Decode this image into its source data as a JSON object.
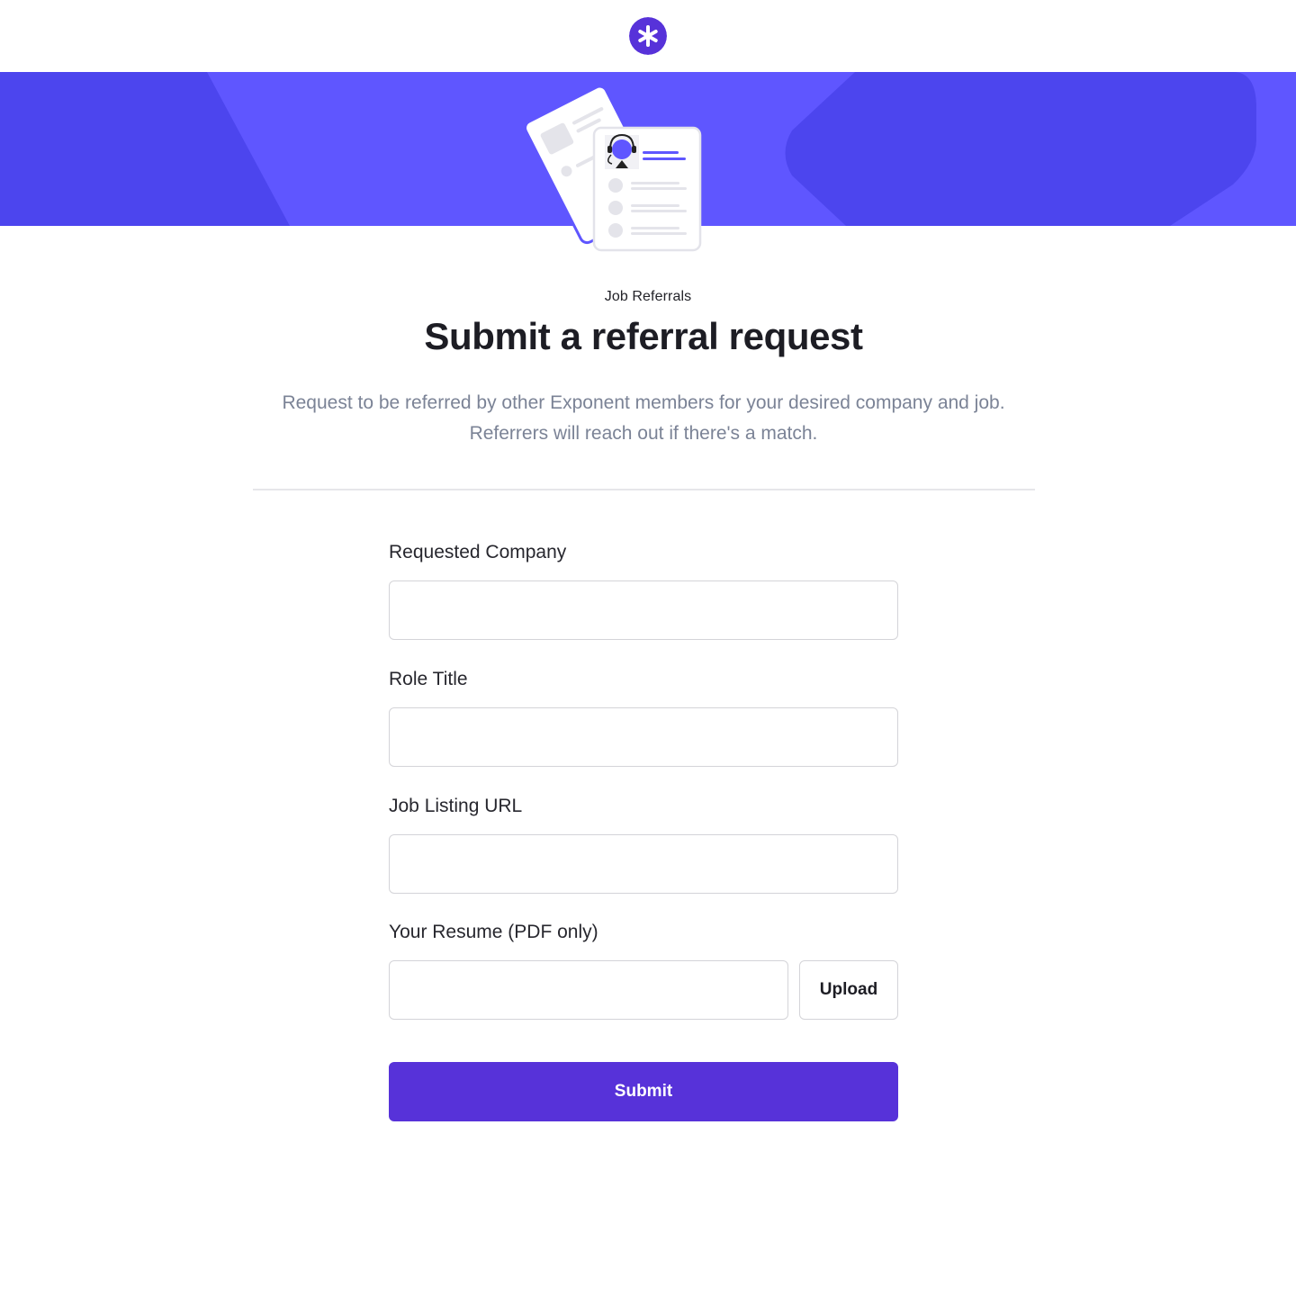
{
  "logo": {
    "icon": "asterisk-icon",
    "color": "#5732d9"
  },
  "banner": {
    "color": "#5f56ff",
    "shape_color": "#4c45ee"
  },
  "header": {
    "eyebrow": "Job Referrals",
    "title": "Submit a referral request",
    "subtitle_line1": "Request to be referred by other Exponent members for your desired company and job.",
    "subtitle_line2": "Referrers will reach out if there's a match."
  },
  "form": {
    "company_label": "Requested Company",
    "company_value": "",
    "role_label": "Role Title",
    "role_value": "",
    "url_label": "Job Listing URL",
    "url_value": "",
    "resume_label": "Your Resume (PDF only)",
    "resume_value": "",
    "upload_label": "Upload",
    "submit_label": "Submit"
  },
  "colors": {
    "accent": "#5732d9",
    "text_muted": "#7b8396",
    "border": "#d4d4d8"
  }
}
